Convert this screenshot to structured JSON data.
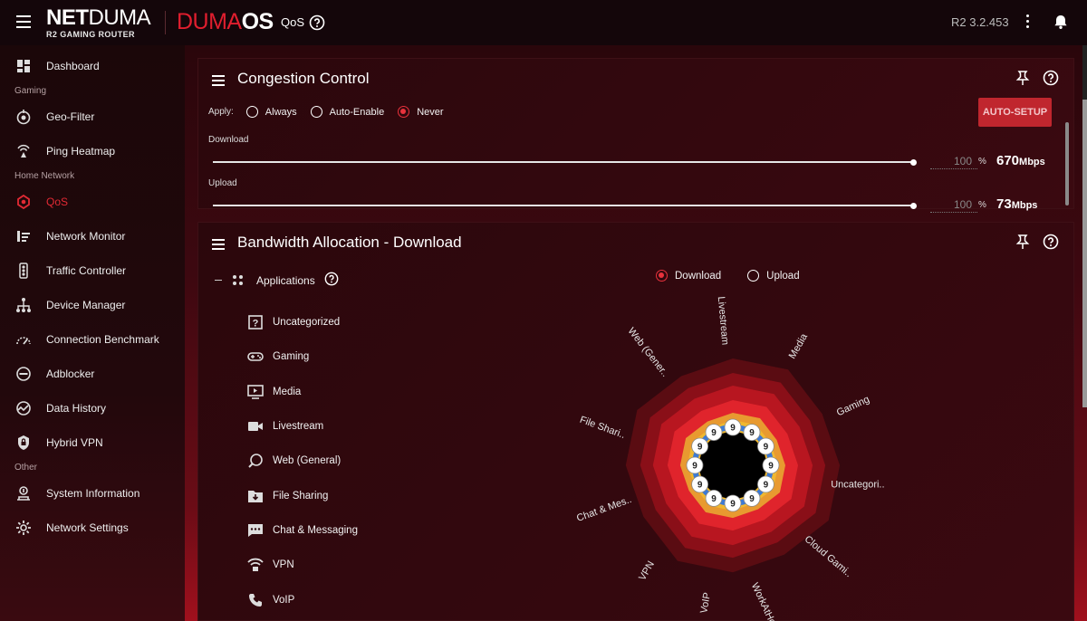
{
  "header": {
    "brand_net": "NET",
    "brand_duma": "DUMA",
    "brand_sub": "R2 GAMING ROUTER",
    "os_duma": "DUMA",
    "os_os": "OS",
    "page": "QoS",
    "version": "R2 3.2.453"
  },
  "sidebar": {
    "items": [
      {
        "label": "Dashboard",
        "icon": "dashboard-icon"
      },
      {
        "section": "Gaming"
      },
      {
        "label": "Geo-Filter",
        "icon": "geo-filter-icon"
      },
      {
        "label": "Ping Heatmap",
        "icon": "ping-heatmap-icon"
      },
      {
        "section": "Home Network"
      },
      {
        "label": "QoS",
        "icon": "qos-icon",
        "active": true
      },
      {
        "label": "Network Monitor",
        "icon": "network-monitor-icon"
      },
      {
        "label": "Traffic Controller",
        "icon": "traffic-controller-icon"
      },
      {
        "label": "Device Manager",
        "icon": "device-manager-icon"
      },
      {
        "label": "Connection Benchmark",
        "icon": "benchmark-icon"
      },
      {
        "label": "Adblocker",
        "icon": "adblocker-icon"
      },
      {
        "label": "Data History",
        "icon": "data-history-icon"
      },
      {
        "label": "Hybrid VPN",
        "icon": "hybrid-vpn-icon"
      },
      {
        "section": "Other"
      },
      {
        "label": "System Information",
        "icon": "system-info-icon"
      },
      {
        "label": "Network Settings",
        "icon": "gear-icon"
      }
    ]
  },
  "congestion": {
    "title": "Congestion Control",
    "apply_label": "Apply:",
    "options": [
      "Always",
      "Auto-Enable",
      "Never"
    ],
    "selected": "Never",
    "auto_setup": "AUTO-SETUP",
    "download_label": "Download",
    "download_pct": "100",
    "download_speed": "670",
    "upload_label": "Upload",
    "upload_pct": "100",
    "upload_speed": "73",
    "unit": "Mbps",
    "pct_sign": "%"
  },
  "bandwidth": {
    "title": "Bandwidth Allocation - Download",
    "tree_root": "Applications",
    "apps": [
      {
        "label": "Uncategorized",
        "icon": "uncategorized-icon"
      },
      {
        "label": "Gaming",
        "icon": "gamepad-icon"
      },
      {
        "label": "Media",
        "icon": "media-icon"
      },
      {
        "label": "Livestream",
        "icon": "video-camera-icon"
      },
      {
        "label": "Web (General)",
        "icon": "web-icon"
      },
      {
        "label": "File Sharing",
        "icon": "folder-download-icon"
      },
      {
        "label": "Chat & Messaging",
        "icon": "chat-icon"
      },
      {
        "label": "VPN",
        "icon": "vpn-icon"
      },
      {
        "label": "VoIP",
        "icon": "phone-icon"
      }
    ],
    "direction_options": [
      "Download",
      "Upload"
    ],
    "direction_selected": "Download",
    "radar_labels": [
      "Livestream",
      "Media",
      "Gaming",
      "Uncategori..",
      "Cloud Gami..",
      "WorkAtHome",
      "VoIP",
      "VPN",
      "Chat & Mes..",
      "File Shari..",
      "Web (Gener.."
    ],
    "badge_value": "9",
    "badge_count": 12
  },
  "colors": {
    "accent": "#e32a34",
    "ring_outer": "#5a0c12",
    "ring_2": "#8a0f18",
    "ring_3": "#b81620",
    "ring_4": "#e0242c",
    "ring_5": "#e89a30",
    "ring_6": "#f0b830",
    "badge_ring": "#3a7ad8"
  }
}
